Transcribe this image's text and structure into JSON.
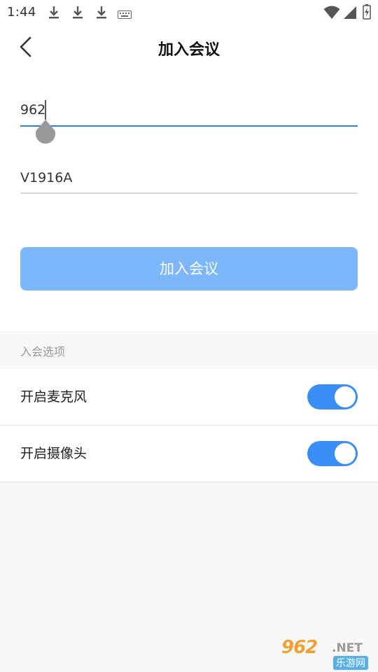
{
  "status_bar": {
    "time": "1:44",
    "left_icons": [
      "download-icon",
      "download-icon",
      "download-icon",
      "keyboard-icon"
    ],
    "right_icons": [
      "wifi-icon",
      "signal-icon",
      "battery-icon"
    ]
  },
  "header": {
    "title": "加入会议",
    "back_icon": "chevron-left-icon"
  },
  "form": {
    "meeting_id": {
      "value": "962"
    },
    "name": {
      "value": "V1916A"
    },
    "join_label": "加入会议"
  },
  "options": {
    "section_label": "入会选项",
    "items": [
      {
        "label": "开启麦克风",
        "enabled": true
      },
      {
        "label": "开启摄像头",
        "enabled": true
      }
    ]
  },
  "watermark": {
    "main": "962",
    "net": ".NET",
    "sub": "乐游网"
  },
  "colors": {
    "accent": "#3a8ef6",
    "button_disabled": "#7db7fb",
    "input_active_line": "#2f7ee6",
    "input_line": "#d8d8d8",
    "section_bg": "#f7f7f7"
  }
}
